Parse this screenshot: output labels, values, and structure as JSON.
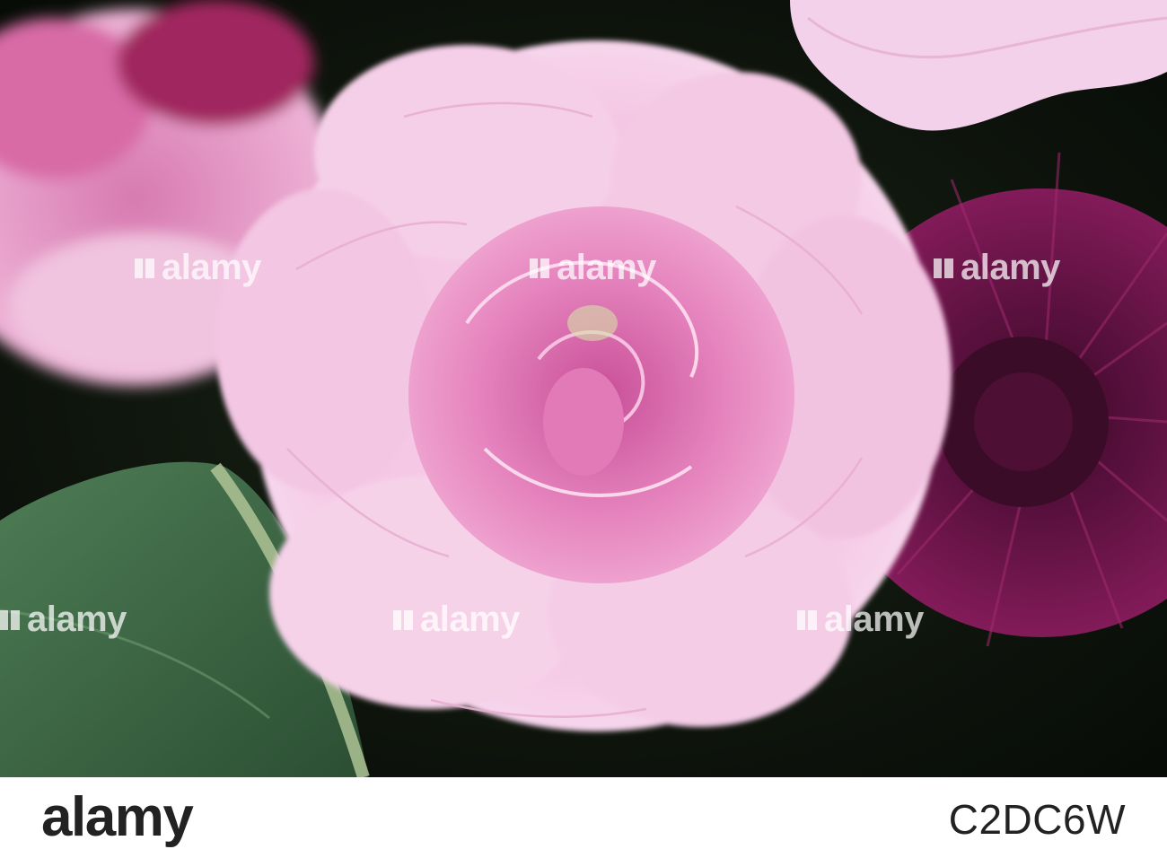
{
  "watermark": {
    "text": "alamy"
  },
  "footer": {
    "brand": "alamy",
    "image_code": "C2DC6W"
  },
  "colors": {
    "background": "#0d150c",
    "carnation_outer": "#f3c3e2",
    "carnation_inner": "#e47fbd",
    "gerbera": "#7a1552",
    "leaf": "#3d6b45"
  }
}
